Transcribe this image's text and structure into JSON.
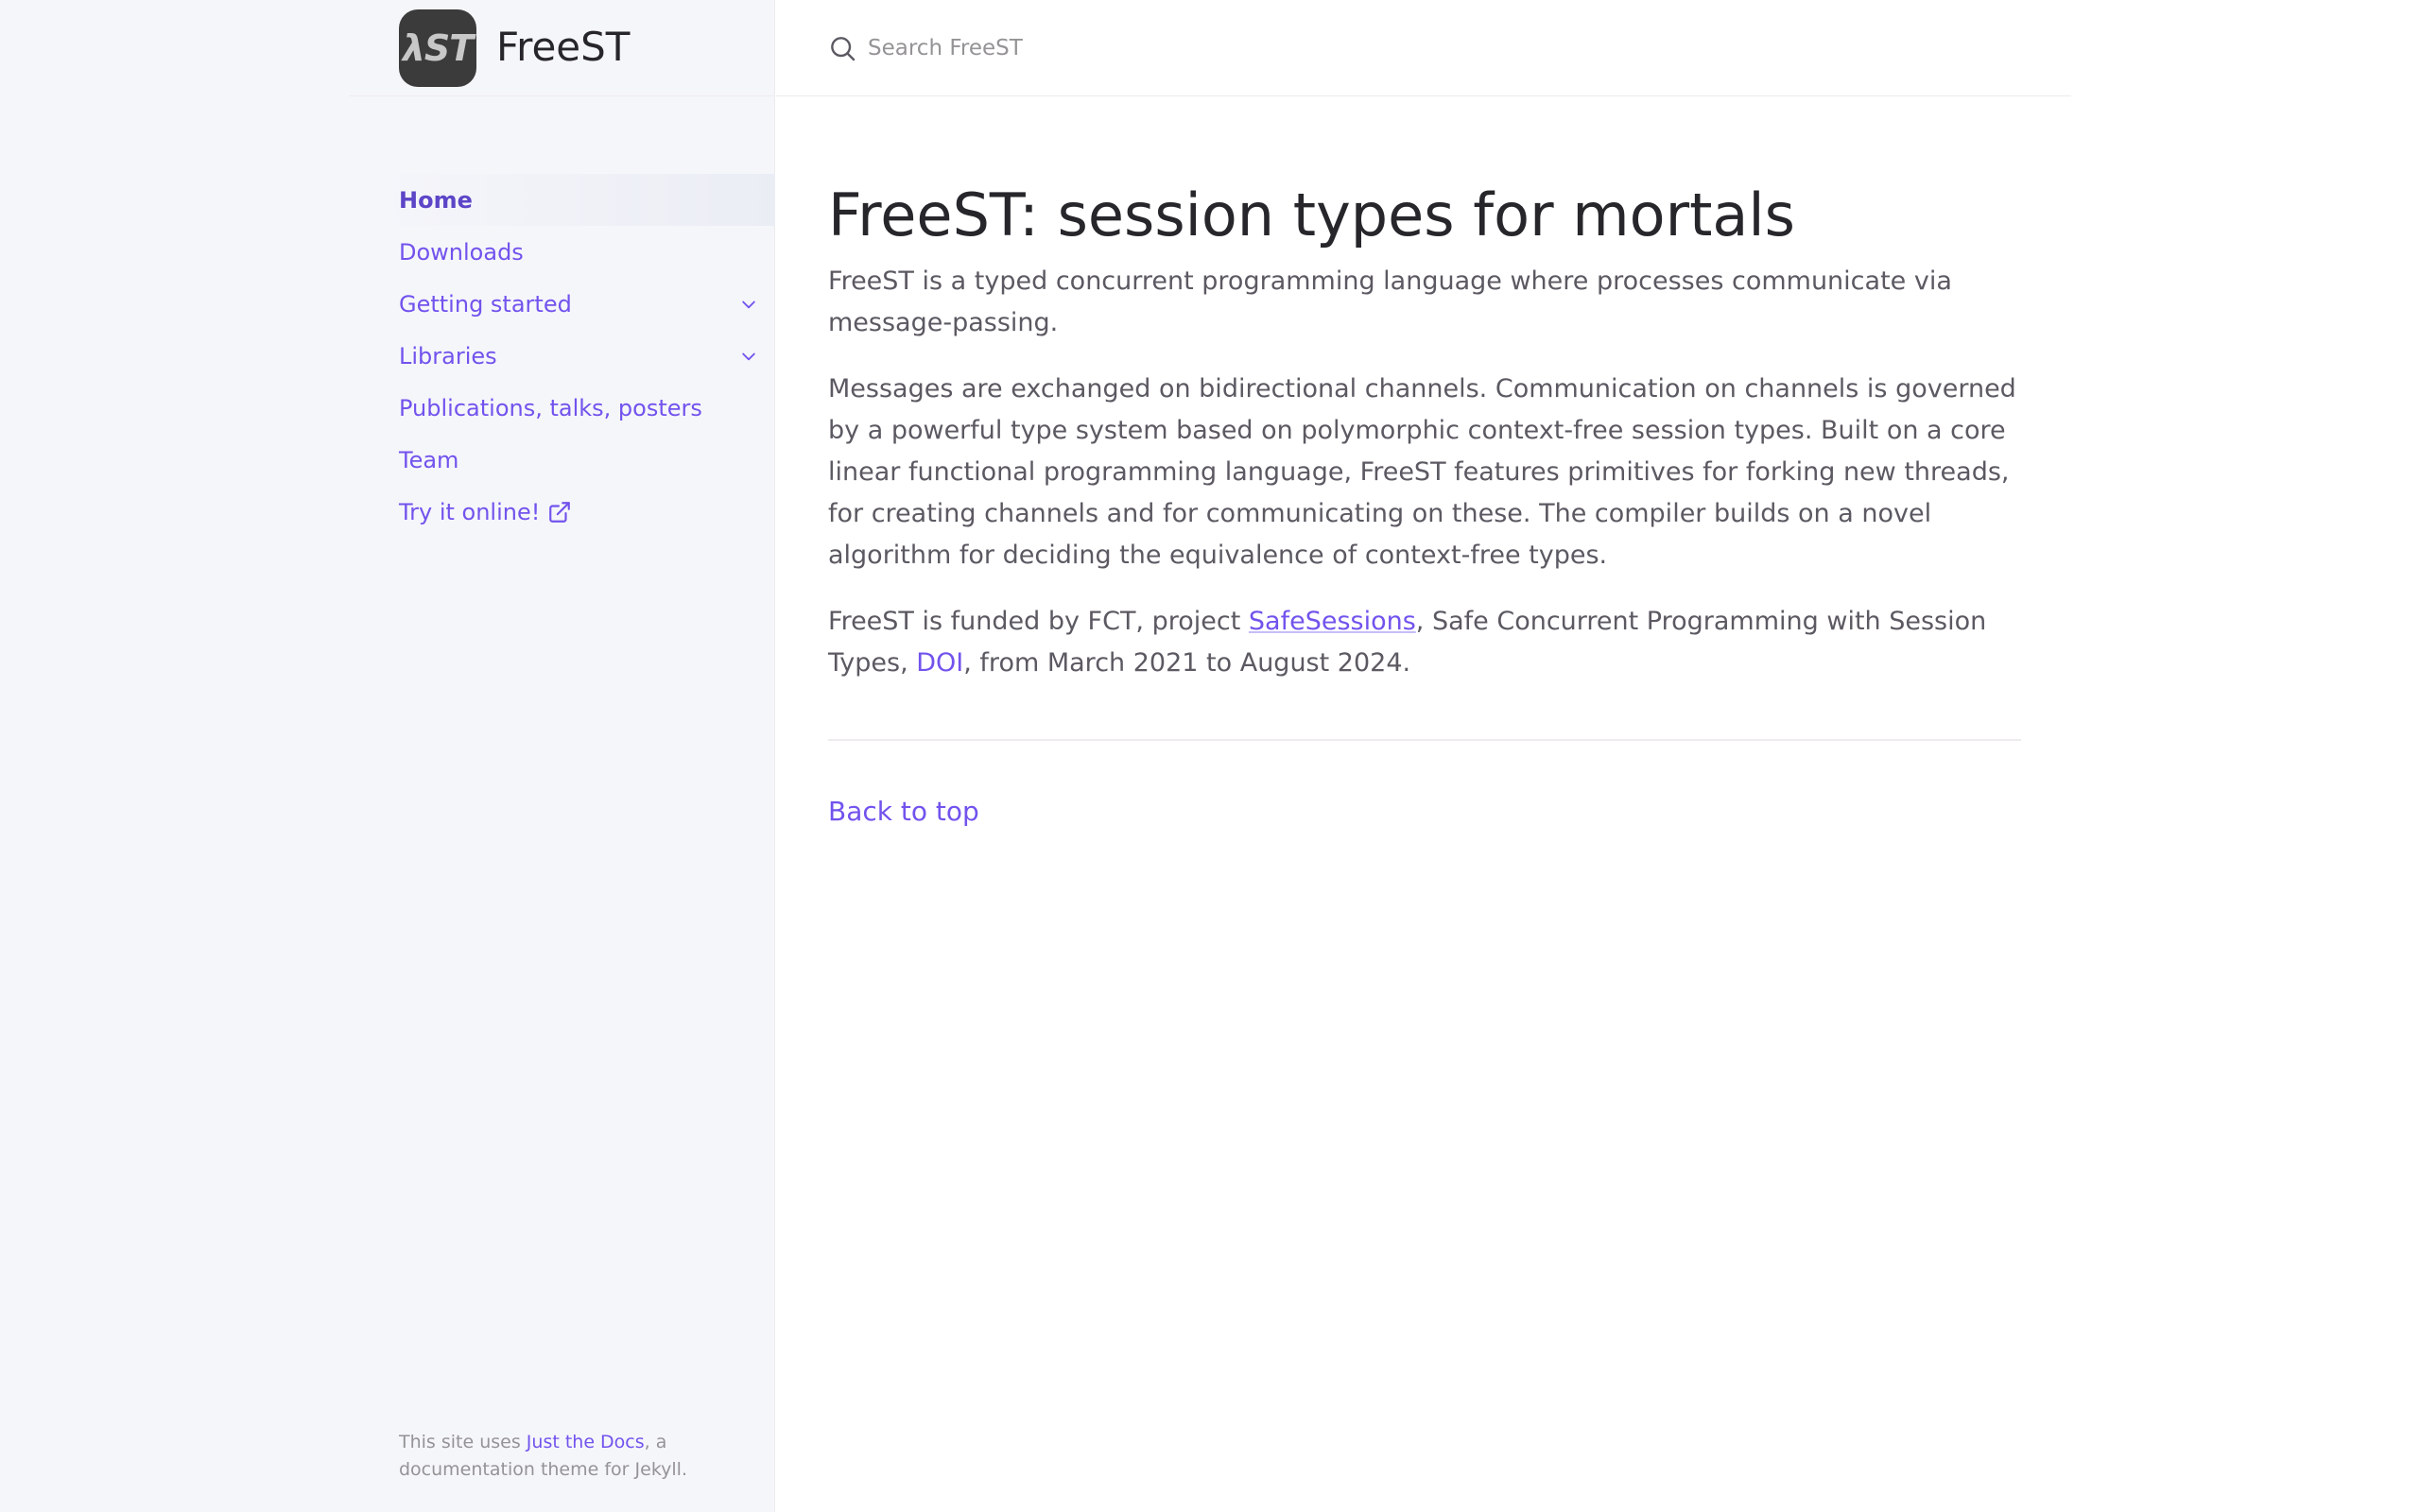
{
  "site": {
    "logo_text": "λST",
    "title": "FreeST"
  },
  "search": {
    "placeholder": "Search FreeST"
  },
  "nav": {
    "items": [
      {
        "label": "Home",
        "active": true
      },
      {
        "label": "Downloads"
      },
      {
        "label": "Getting started",
        "expandable": true
      },
      {
        "label": "Libraries",
        "expandable": true
      },
      {
        "label": "Publications, talks, posters"
      },
      {
        "label": "Team"
      },
      {
        "label": "Try it online!",
        "external": true
      }
    ]
  },
  "footer": {
    "prefix": "This site uses ",
    "link_text": "Just the Docs",
    "suffix": ", a documentation theme for Jekyll."
  },
  "main": {
    "title": "FreeST: session types for mortals",
    "intro": "FreeST is a typed concurrent programming language where processes communicate via message-passing.",
    "description": "Messages are exchanged on bidirectional channels. Communication on channels is governed by a powerful type system based on polymorphic context-free session types. Built on a core linear functional programming language, FreeST features primitives for forking new threads, for creating channels and for communicating on these. The compiler builds on a novel algorithm for deciding the equivalence of context-free types.",
    "funding": {
      "prefix": "FreeST is funded by FCT, project ",
      "project_link": "SafeSessions",
      "middle": ", Safe Concurrent Programming with Session Types, ",
      "doi_link": "DOI",
      "suffix": ", from March 2021 to August 2024."
    },
    "back_to_top": "Back to top"
  },
  "colors": {
    "accent": "#7253ed",
    "sidebar_bg": "#f5f6fa",
    "text": "#5c5962",
    "heading": "#27262b"
  }
}
